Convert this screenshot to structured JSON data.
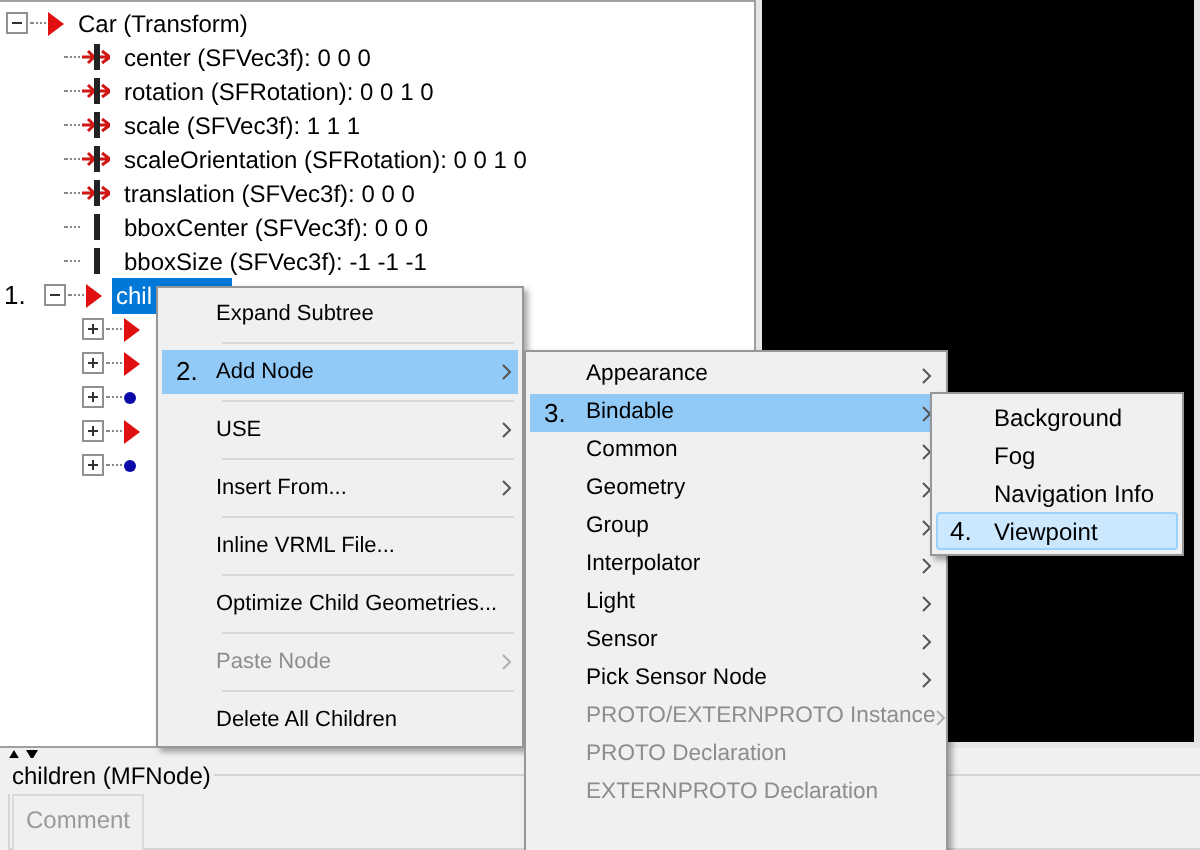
{
  "tree": [
    {
      "label": "Car (Transform)",
      "kind": "node",
      "expanded": true,
      "selected": false,
      "children": [
        {
          "label": "center (SFVec3f): 0  0  0",
          "kind": "exposed-field",
          "selected": false
        },
        {
          "label": "rotation (SFRotation): 0  0  1  0",
          "kind": "exposed-field",
          "selected": false
        },
        {
          "label": "scale (SFVec3f): 1  1  1",
          "kind": "exposed-field",
          "selected": false
        },
        {
          "label": "scaleOrientation (SFRotation): 0  0  1  0",
          "kind": "exposed-field",
          "selected": false
        },
        {
          "label": "translation (SFVec3f): 0  0  0",
          "kind": "exposed-field",
          "selected": false
        },
        {
          "label": "bboxCenter (SFVec3f): 0  0  0",
          "kind": "field",
          "selected": false
        },
        {
          "label": "bboxSize (SFVec3f): -1 -1 -1",
          "kind": "field",
          "selected": false
        },
        {
          "label": "chil",
          "step": "1.",
          "kind": "node",
          "expanded": true,
          "selected": true,
          "children": [
            {
              "kind": "node",
              "expanded": false,
              "selected": false
            },
            {
              "kind": "node",
              "expanded": false,
              "selected": false
            },
            {
              "kind": "dot",
              "expanded": false,
              "selected": false
            },
            {
              "kind": "node",
              "expanded": false,
              "selected": false
            },
            {
              "kind": "dot",
              "expanded": false,
              "selected": false
            }
          ]
        }
      ]
    }
  ],
  "context_menu": [
    {
      "label": "Expand Subtree",
      "submenu": false,
      "disabled": false,
      "selected": false
    },
    {
      "label": "Add Node",
      "step": "2.",
      "submenu": true,
      "disabled": false,
      "selected": true
    },
    {
      "label": "USE",
      "submenu": true,
      "disabled": false,
      "selected": false
    },
    {
      "label": "Insert From...",
      "submenu": true,
      "disabled": false,
      "selected": false
    },
    {
      "label": "Inline VRML File...",
      "submenu": false,
      "disabled": false,
      "selected": false
    },
    {
      "label": "Optimize Child Geometries...",
      "submenu": false,
      "disabled": false,
      "selected": false
    },
    {
      "label": "Paste Node",
      "submenu": true,
      "disabled": true,
      "selected": false
    },
    {
      "label": "Delete All Children",
      "submenu": false,
      "disabled": false,
      "selected": false
    }
  ],
  "add_node_menu": [
    {
      "label": "Appearance",
      "submenu": true,
      "disabled": false,
      "selected": false
    },
    {
      "label": "Bindable",
      "step": "3.",
      "submenu": true,
      "disabled": false,
      "selected": true
    },
    {
      "label": "Common",
      "submenu": true,
      "disabled": false,
      "selected": false
    },
    {
      "label": "Geometry",
      "submenu": true,
      "disabled": false,
      "selected": false
    },
    {
      "label": "Group",
      "submenu": true,
      "disabled": false,
      "selected": false
    },
    {
      "label": "Interpolator",
      "submenu": true,
      "disabled": false,
      "selected": false
    },
    {
      "label": "Light",
      "submenu": true,
      "disabled": false,
      "selected": false
    },
    {
      "label": "Sensor",
      "submenu": true,
      "disabled": false,
      "selected": false
    },
    {
      "label": "Pick Sensor Node",
      "submenu": true,
      "disabled": false,
      "selected": false
    },
    {
      "label": "PROTO/EXTERNPROTO Instance",
      "submenu": true,
      "disabled": true,
      "selected": false
    },
    {
      "label": "PROTO Declaration",
      "submenu": false,
      "disabled": true,
      "selected": false
    },
    {
      "label": "EXTERNPROTO Declaration",
      "submenu": false,
      "disabled": true,
      "selected": false
    }
  ],
  "bindable_menu": [
    {
      "label": "Background",
      "submenu": false,
      "disabled": false,
      "selected": false
    },
    {
      "label": "Fog",
      "submenu": false,
      "disabled": false,
      "selected": false
    },
    {
      "label": "Navigation Info",
      "submenu": false,
      "disabled": false,
      "selected": false
    },
    {
      "label": "Viewpoint",
      "step": "4.",
      "submenu": false,
      "disabled": false,
      "selected": true
    }
  ],
  "field_panel": {
    "title": "children (MFNode)",
    "tabs": [
      {
        "label": "Comment",
        "selected": false
      }
    ]
  }
}
